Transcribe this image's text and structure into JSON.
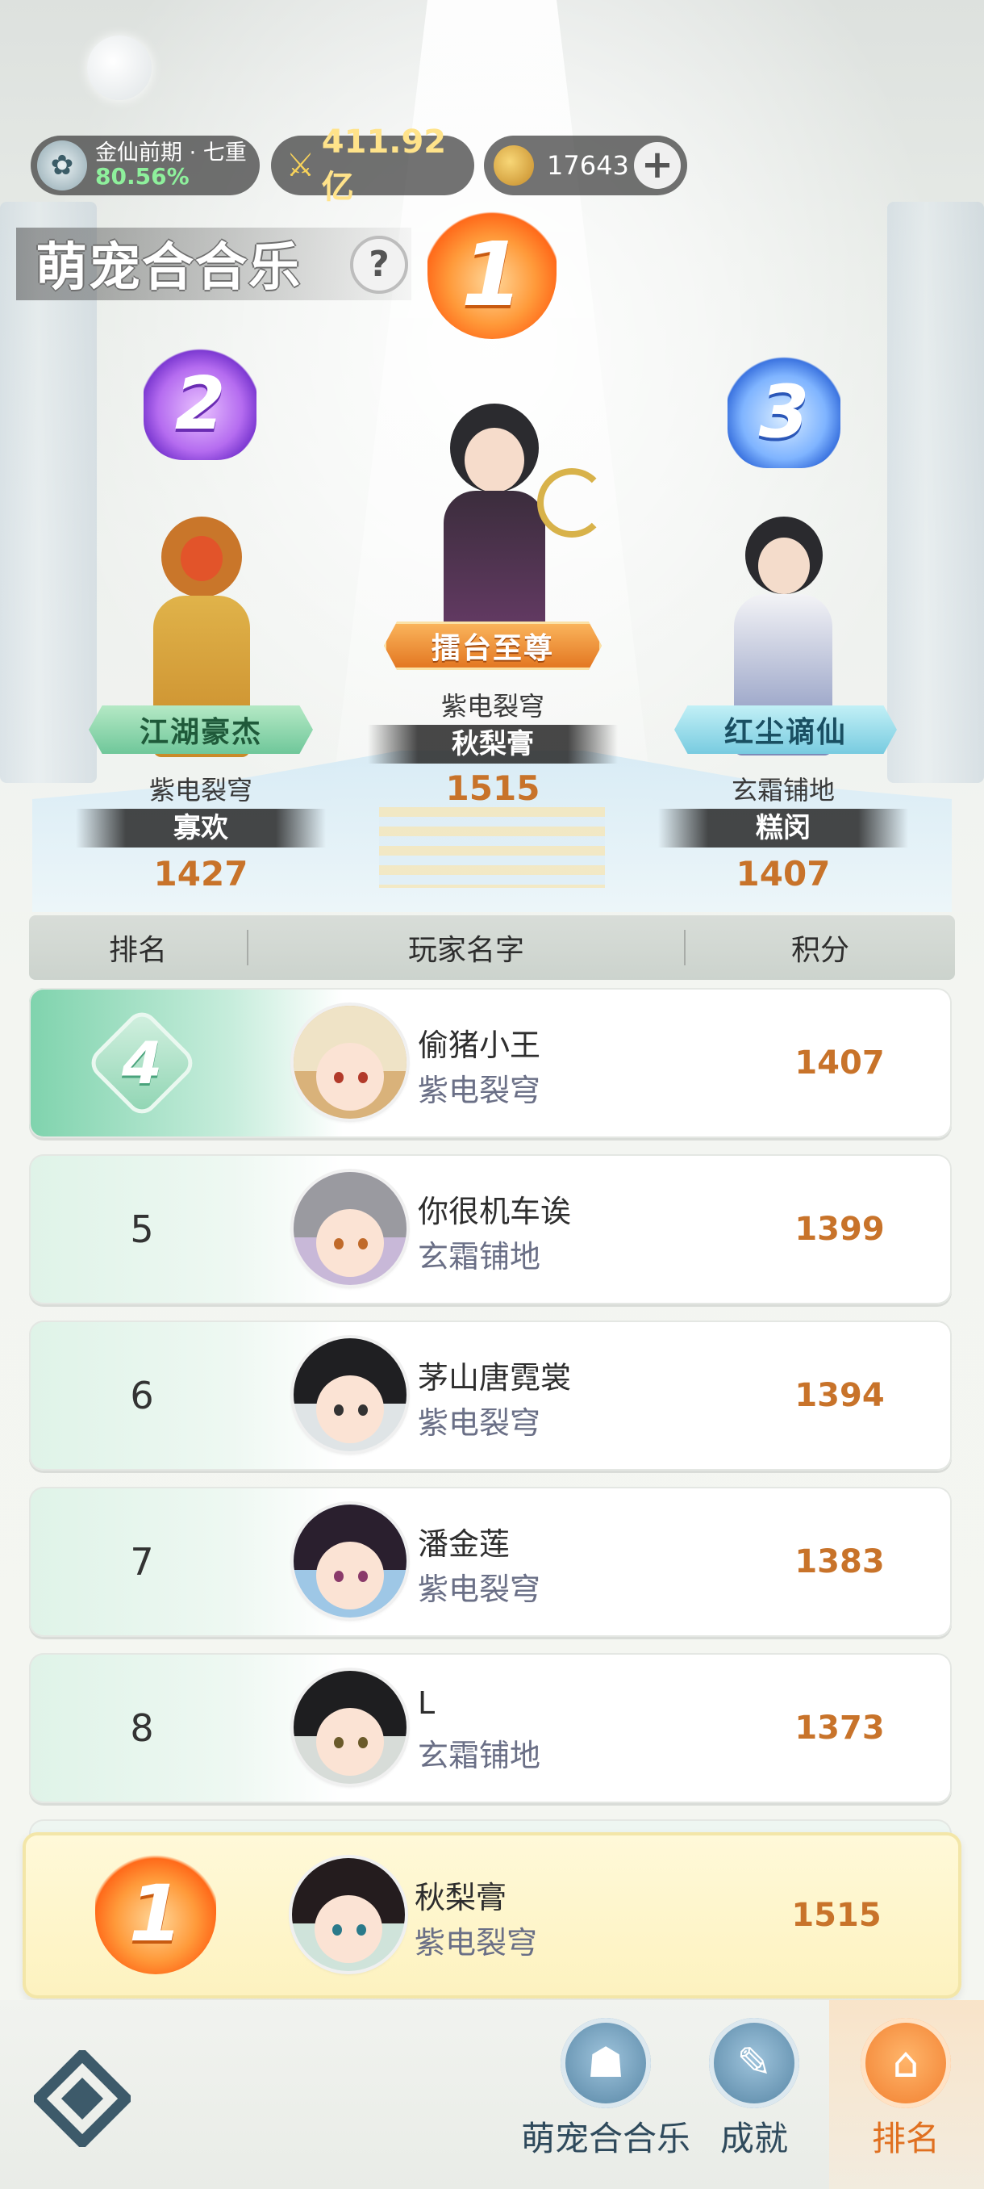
{
  "status_bar": {
    "realm_name": "金仙前期 · 七重",
    "realm_progress": "80.56%",
    "combat_power": "411.92亿",
    "currency_amount": "17643",
    "add_label": "+"
  },
  "page": {
    "title": "萌宠合合乐",
    "help_label": "?"
  },
  "podium": [
    {
      "rank": "1",
      "title": "擂台至尊",
      "server": "紫电裂穹",
      "name": "秋梨膏",
      "score": "1515"
    },
    {
      "rank": "2",
      "title": "江湖豪杰",
      "server": "紫电裂穹",
      "name": "寡欢",
      "score": "1427"
    },
    {
      "rank": "3",
      "title": "红尘谪仙",
      "server": "玄霜铺地",
      "name": "糕闵",
      "score": "1407"
    }
  ],
  "table": {
    "headers": {
      "rank": "排名",
      "player": "玩家名字",
      "score": "积分"
    },
    "rows": [
      {
        "rank": "4",
        "name": "偷猪小王",
        "server": "紫电裂穹",
        "score": "1407"
      },
      {
        "rank": "5",
        "name": "你很机车诶",
        "server": "玄霜铺地",
        "score": "1399"
      },
      {
        "rank": "6",
        "name": "茅山唐霓裳",
        "server": "紫电裂穹",
        "score": "1394"
      },
      {
        "rank": "7",
        "name": "潘金莲",
        "server": "紫电裂穹",
        "score": "1383"
      },
      {
        "rank": "8",
        "name": "L",
        "server": "玄霜铺地",
        "score": "1373"
      }
    ]
  },
  "my_rank": {
    "rank": "1",
    "name": "秋梨膏",
    "server": "紫电裂穹",
    "score": "1515"
  },
  "nav": {
    "tabs": [
      {
        "label": "萌宠合合乐",
        "icon": "mask-icon"
      },
      {
        "label": "成就",
        "icon": "scroll-icon"
      },
      {
        "label": "排名",
        "icon": "palace-icon",
        "active": true
      }
    ],
    "back_icon": "back-diamond-icon"
  }
}
